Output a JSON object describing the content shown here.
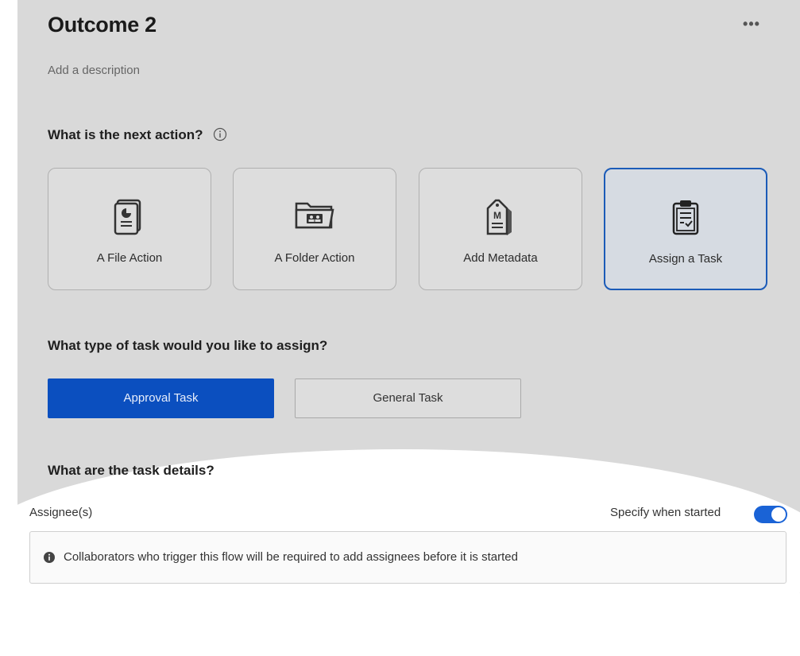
{
  "header": {
    "title": "Outcome 2",
    "more_label": "•••",
    "description_placeholder": "Add a description"
  },
  "next_action": {
    "question": "What is the next action?",
    "info_icon": "info-circle-icon",
    "cards": [
      {
        "label": "A File Action",
        "icon": "file-document-icon",
        "selected": false
      },
      {
        "label": "A Folder Action",
        "icon": "folder-users-icon",
        "selected": false
      },
      {
        "label": "Add Metadata",
        "icon": "metadata-tag-icon",
        "selected": false
      },
      {
        "label": "Assign a Task",
        "icon": "clipboard-task-icon",
        "selected": true
      }
    ]
  },
  "task_type": {
    "question": "What type of task would you like to assign?",
    "options": [
      {
        "label": "Approval Task",
        "selected": true
      },
      {
        "label": "General Task",
        "selected": false
      }
    ]
  },
  "task_details": {
    "question": "What are the task details?",
    "assignee_label": "Assignee(s)",
    "specify_label": "Specify when started",
    "specify_enabled": true,
    "info_message": "Collaborators who trigger this flow will be required to add assignees before it is started"
  },
  "colors": {
    "accent": "#0b4fbf",
    "selected_border": "#1b5bb8",
    "panel_bg": "#d9d9d9"
  }
}
